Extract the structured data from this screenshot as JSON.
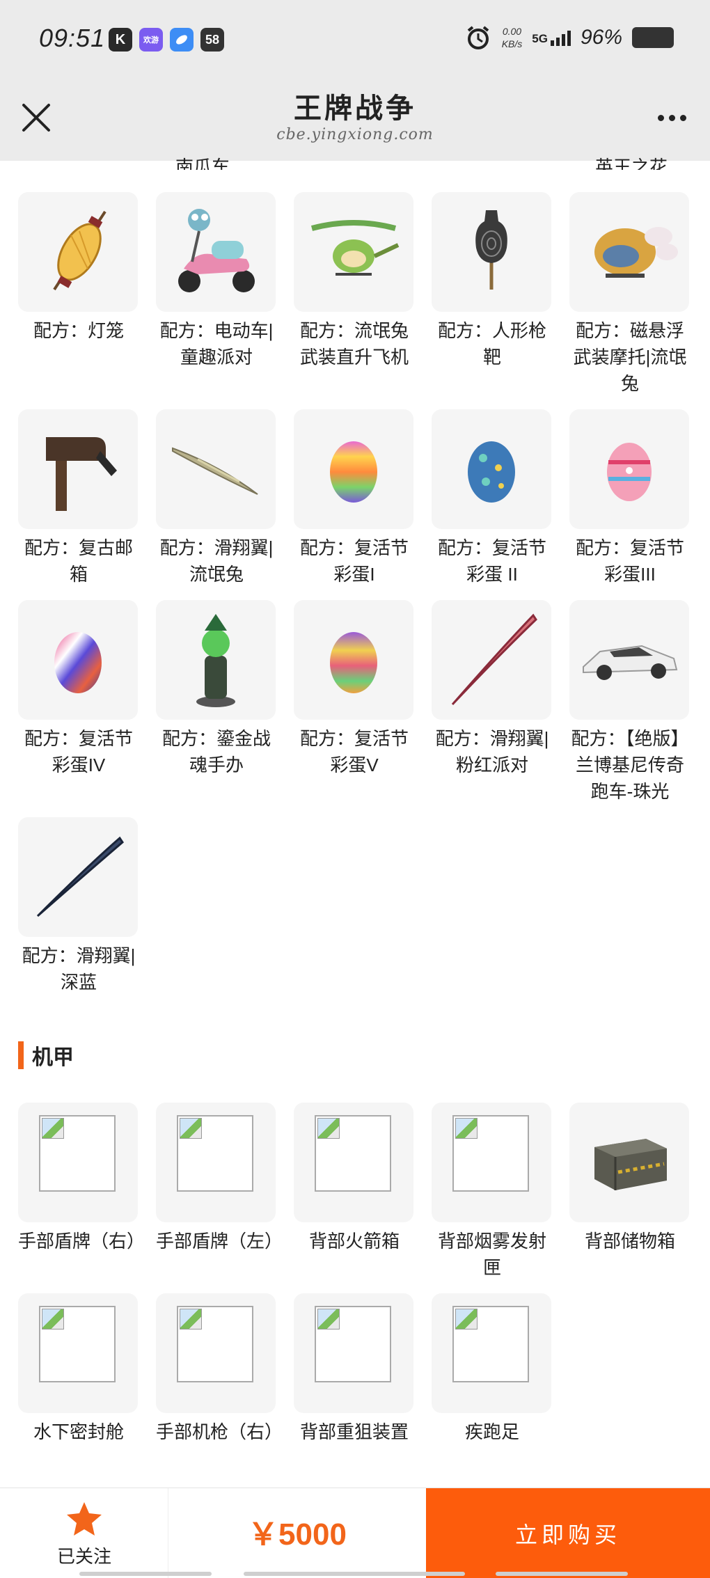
{
  "status_bar": {
    "time": "09:51",
    "apps": [
      "K",
      "欢游",
      "",
      "58"
    ],
    "net_speed_value": "0.00",
    "net_speed_unit": "KB/s",
    "network": "5G",
    "battery": "96%"
  },
  "nav": {
    "title": "王牌战争",
    "subtitle": "cbe.yingxiong.com",
    "close_icon": "close-icon",
    "more_icon": "more-icon"
  },
  "cutoff_labels": [
    "南瓜车",
    "英王之花"
  ],
  "props_items": [
    {
      "label": "配方：灯笼",
      "icon": "lantern-icon"
    },
    {
      "label": "配方：电动车|童趣派对",
      "icon": "scooter-icon"
    },
    {
      "label": "配方：流氓兔武装直升飞机",
      "icon": "helicopter-icon"
    },
    {
      "label": "配方：人形枪靶",
      "icon": "target-icon"
    },
    {
      "label": "配方：磁悬浮武装摩托|流氓兔",
      "icon": "hover-bike-icon"
    },
    {
      "label": "配方：复古邮箱",
      "icon": "mailbox-icon"
    },
    {
      "label": "配方：滑翔翼|流氓兔",
      "icon": "glider-icon"
    },
    {
      "label": "配方：复活节彩蛋I",
      "icon": "easter-egg-icon"
    },
    {
      "label": "配方：复活节彩蛋 II",
      "icon": "easter-egg-icon"
    },
    {
      "label": "配方：复活节彩蛋III",
      "icon": "easter-egg-icon"
    },
    {
      "label": "配方：复活节彩蛋IV",
      "icon": "easter-egg-icon"
    },
    {
      "label": "配方：鎏金战魂手办",
      "icon": "figurine-icon"
    },
    {
      "label": "配方：复活节彩蛋V",
      "icon": "easter-egg-icon"
    },
    {
      "label": "配方：滑翔翼|粉红派对",
      "icon": "glider-icon"
    },
    {
      "label": "配方：【绝版】兰博基尼传奇跑车-珠光",
      "icon": "sports-car-icon"
    },
    {
      "label": "配方：滑翔翼|深蓝",
      "icon": "glider-icon"
    }
  ],
  "mecha_section": {
    "title": "机甲",
    "items": [
      {
        "label": "手部盾牌（右）",
        "icon": "broken-image-icon"
      },
      {
        "label": "手部盾牌（左）",
        "icon": "broken-image-icon"
      },
      {
        "label": "背部火箭箱",
        "icon": "broken-image-icon"
      },
      {
        "label": "背部烟雾发射匣",
        "icon": "broken-image-icon"
      },
      {
        "label": "背部储物箱",
        "icon": "storage-crate-icon"
      },
      {
        "label": "水下密封舱",
        "icon": "broken-image-icon"
      },
      {
        "label": "手部机枪（右）",
        "icon": "broken-image-icon"
      },
      {
        "label": "背部重狙装置",
        "icon": "broken-image-icon"
      },
      {
        "label": "疾跑足",
        "icon": "broken-image-icon"
      }
    ]
  },
  "bottom_bar": {
    "follow_label": "已关注",
    "price": "￥5000",
    "buy_label": "立即购买",
    "accent_color": "#fd5c0c",
    "star_color": "#f2651a"
  }
}
